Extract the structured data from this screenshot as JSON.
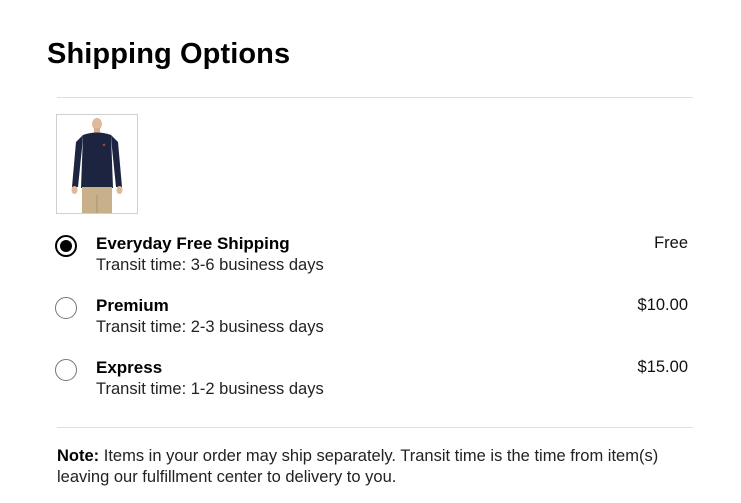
{
  "page": {
    "title": "Shipping Options"
  },
  "product": {
    "image_icon": "sweater-product-image",
    "colors": {
      "sweater": "#1c2440",
      "pants": "#c8b08a",
      "skin": "#e0b89a"
    }
  },
  "options": [
    {
      "name": "Everyday Free Shipping",
      "transit": "Transit time: 3-6 business days",
      "price": "Free",
      "selected": true
    },
    {
      "name": "Premium",
      "transit": "Transit time: 2-3 business days",
      "price": "$10.00",
      "selected": false
    },
    {
      "name": "Express",
      "transit": "Transit time: 1-2 business days",
      "price": "$15.00",
      "selected": false
    }
  ],
  "note": {
    "label": "Note:",
    "text": " Items in your order may ship separately. Transit time is the time from item(s) leaving our fulfillment center to delivery to you."
  }
}
